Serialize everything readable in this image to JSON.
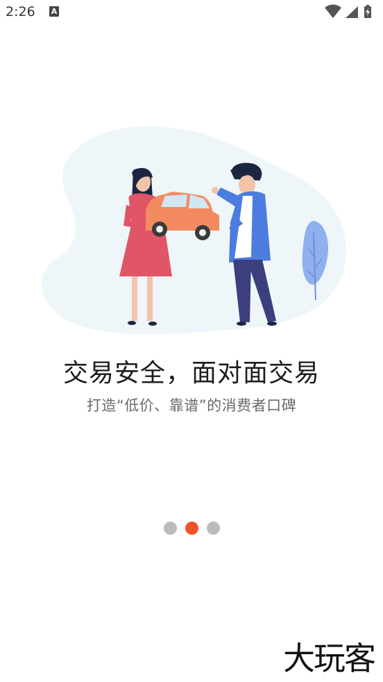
{
  "status_bar": {
    "time": "2:26",
    "notification_icon": "A"
  },
  "onboarding": {
    "title": "交易安全，面对面交易",
    "subtitle": "打造“低价、靠谱”的消费者口碑",
    "page_indicator": {
      "total": 3,
      "current": 2
    }
  },
  "brand": {
    "logo_text": "大玩客"
  },
  "colors": {
    "accent": "#f0522a",
    "dot_inactive": "#bbbbbb",
    "illustration_bg": "#eef6f9",
    "car": "#f48a5f",
    "jacket": "#4c7ce0",
    "dress": "#e05567"
  }
}
